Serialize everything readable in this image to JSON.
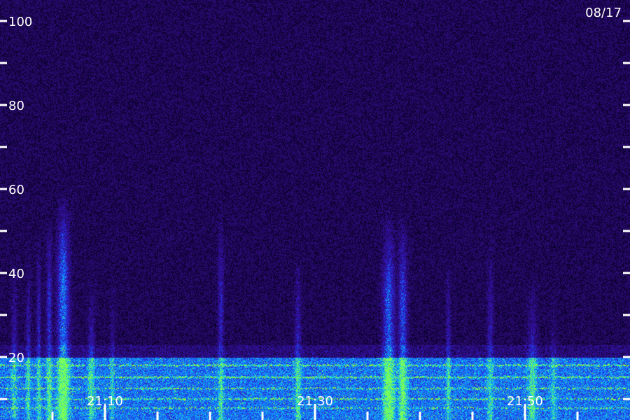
{
  "chart_data": {
    "type": "heatmap",
    "date_label": "08/17",
    "y_axis": {
      "min": 0,
      "max": 100,
      "labeled_ticks": [
        "20",
        "40",
        "60",
        "80",
        "100"
      ],
      "labeled_values": [
        20,
        40,
        60,
        80,
        100
      ],
      "minor_values": [
        10,
        30,
        50,
        70,
        90
      ]
    },
    "x_axis": {
      "tick_labels": [
        "21:10",
        "21:30",
        "21:50"
      ],
      "start_minute": 0,
      "end_minute": 60,
      "label_minutes": [
        10,
        30,
        50
      ],
      "tick_minutes": [
        5,
        10,
        15,
        20,
        25,
        30,
        35,
        40,
        45,
        50,
        55
      ]
    },
    "grid": false,
    "colors": {
      "background": "#2a0a6a",
      "low_band": "#1a6aff",
      "bright_line": "#8cff3c",
      "text": "#ffffff"
    }
  }
}
